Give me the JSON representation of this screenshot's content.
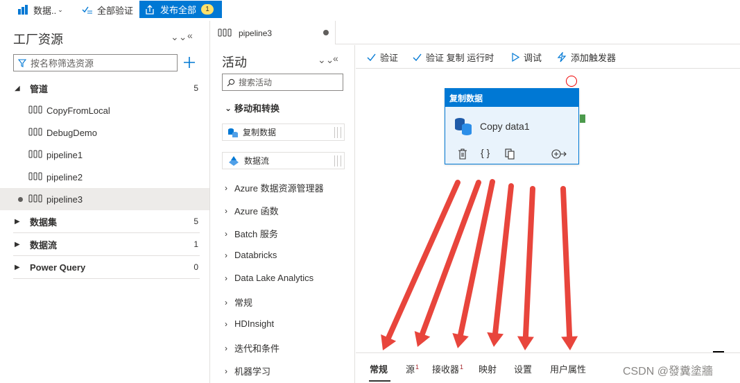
{
  "topbar": {
    "data_label": "数据..",
    "validate_all": "全部验证",
    "publish_all": "发布全部",
    "publish_count": "1"
  },
  "factory": {
    "title": "工厂资源",
    "filter_placeholder": "按名称筛选资源",
    "categories": [
      {
        "name": "管道",
        "count": "5"
      },
      {
        "name": "数据集",
        "count": "5"
      },
      {
        "name": "数据流",
        "count": "1"
      },
      {
        "name": "Power Query",
        "count": "0"
      }
    ],
    "pipelines": [
      "CopyFromLocal",
      "DebugDemo",
      "pipeline1",
      "pipeline2",
      "pipeline3"
    ]
  },
  "editor_tab": {
    "name": "pipeline3"
  },
  "activities": {
    "title": "活动",
    "search_placeholder": "搜索活动",
    "open_group": "移动和转换",
    "items": [
      "复制数据",
      "数据流"
    ],
    "groups": [
      "Azure 数据资源管理器",
      "Azure 函数",
      "Batch 服务",
      "Databricks",
      "Data Lake Analytics",
      "常规",
      "HDInsight",
      "迭代和条件",
      "机器学习"
    ]
  },
  "canvas_toolbar": {
    "validate": "验证",
    "validate_copy_runtime": "验证 复制 运行时",
    "debug": "调试",
    "add_trigger": "添加触发器"
  },
  "node": {
    "type_label": "复制数据",
    "name": "Copy data1",
    "actions_icons": [
      "delete-icon",
      "code-icon",
      "copy-icon",
      "add-output-icon"
    ]
  },
  "property_tabs": [
    {
      "label": "常规",
      "badge": ""
    },
    {
      "label": "源",
      "badge": "1"
    },
    {
      "label": "接收器",
      "badge": "1"
    },
    {
      "label": "映射",
      "badge": ""
    },
    {
      "label": "设置",
      "badge": ""
    },
    {
      "label": "用户属性",
      "badge": ""
    }
  ],
  "watermark": "CSDN @發糞塗牆",
  "colors": {
    "accent": "#0078d4",
    "badge": "#ffe16b",
    "arrow": "#e8453c",
    "success": "#4c9a4c"
  }
}
